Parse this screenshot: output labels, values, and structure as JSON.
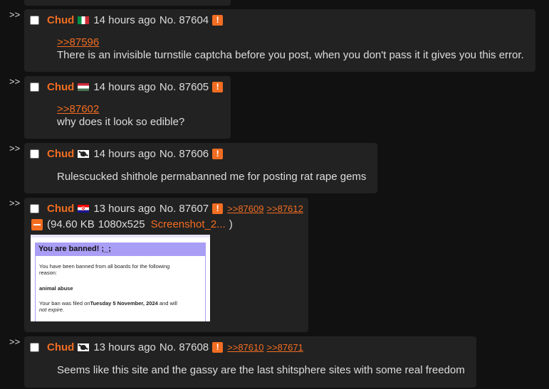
{
  "reply_arrow": ">>",
  "icons": {
    "warning": "!",
    "collapse": "minus-icon"
  },
  "colors": {
    "background": "#111111",
    "post_bg": "#222222",
    "accent": "#f26d21",
    "text": "#dddddd"
  },
  "posts": [
    {
      "name": "Chud",
      "flag": "italy-flag",
      "time": "14 hours ago",
      "no": "No. 87604",
      "quote": ">>87596",
      "text": "There is an invisible turnstile captcha before you post, when you don't pass it it gives you this error."
    },
    {
      "name": "Chud",
      "flag": "hungary-flag",
      "time": "14 hours ago",
      "no": "No. 87605",
      "quote": ">>87602",
      "text": "why does it look so edible?"
    },
    {
      "name": "Chud",
      "flag": "pirate-flag",
      "time": "14 hours ago",
      "no": "No. 87606",
      "text": "Rulescucked shithole permabanned me for posting rat rape gems"
    },
    {
      "name": "Chud",
      "flag": "croatia-flag",
      "time": "13 hours ago",
      "no": "No. 87607",
      "replies": [
        ">>87609",
        ">>87612"
      ],
      "file": {
        "size": "(94.60 KB",
        "dims": "1080x525",
        "name": "Screenshot_2...",
        "close": ")"
      },
      "thumb": {
        "title": "You are banned! ;_;",
        "line1": "You have been banned from all boards for the following",
        "line2": "reason:",
        "reason": "animal abuse",
        "filed_prefix": "Your ban was filed on",
        "filed_date": "Tuesday 5 November, 2024",
        "filed_suffix": " and will",
        "expire": "not expire."
      }
    },
    {
      "name": "Chud",
      "flag": "pirate-flag",
      "time": "13 hours ago",
      "no": "No. 87608",
      "replies": [
        ">>87610",
        ">>87671"
      ],
      "text": "Seems like this site and the gassy are the last shitsphere sites with some real freedom"
    }
  ]
}
